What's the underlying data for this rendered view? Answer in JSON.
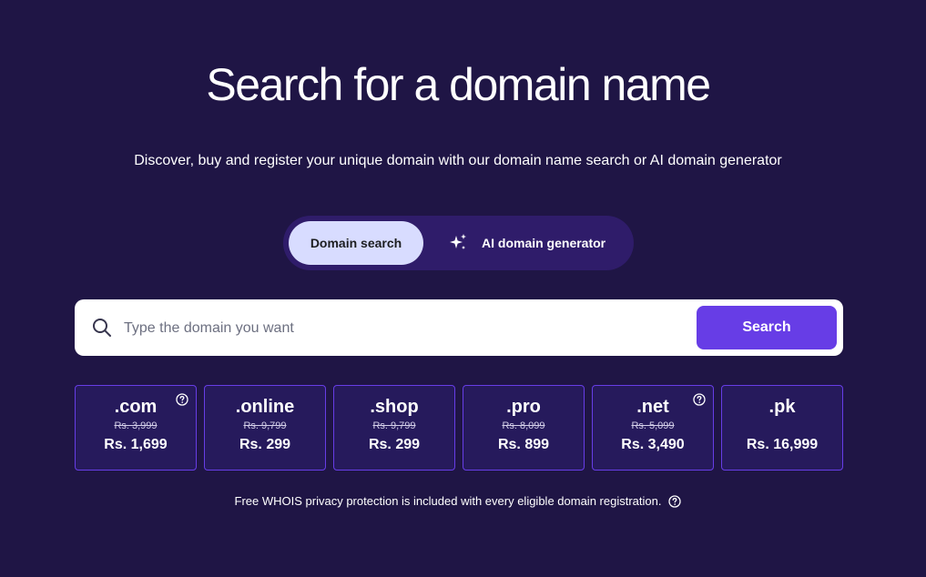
{
  "header": {
    "title": "Search for a domain name",
    "subtitle": "Discover, buy and register your unique domain with our domain name search or AI domain generator"
  },
  "toggle": {
    "domain_search_label": "Domain search",
    "ai_generator_label": "AI domain generator",
    "ai_generator_icon": "sparkle-icon",
    "active": "Domain search"
  },
  "search": {
    "placeholder": "Type the domain you want",
    "value": "",
    "button_label": "Search",
    "icon": "search-icon"
  },
  "tlds": [
    {
      "name": ".com",
      "old_price": "Rs. 3,999",
      "price": "Rs. 1,699",
      "has_help": true
    },
    {
      "name": ".online",
      "old_price": "Rs. 9,799",
      "price": "Rs. 299",
      "has_help": false
    },
    {
      "name": ".shop",
      "old_price": "Rs. 9,799",
      "price": "Rs. 299",
      "has_help": false
    },
    {
      "name": ".pro",
      "old_price": "Rs. 8,099",
      "price": "Rs. 899",
      "has_help": false
    },
    {
      "name": ".net",
      "old_price": "Rs. 5,099",
      "price": "Rs. 3,490",
      "has_help": true
    },
    {
      "name": ".pk",
      "old_price": "",
      "price": "Rs. 16,999",
      "has_help": false
    }
  ],
  "footer": {
    "note": "Free WHOIS privacy protection is included with every eligible domain registration.",
    "icon": "help-circle-icon"
  },
  "colors": {
    "background": "#1f1545",
    "accent": "#673de6",
    "toggle_active": "#d8dcff",
    "toggle_track": "#2f1c6a",
    "card_bg": "#261a5c"
  }
}
